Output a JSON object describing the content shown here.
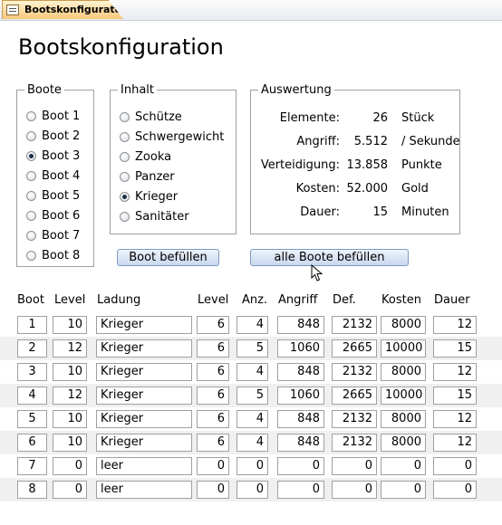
{
  "tab": {
    "label": "Bootskonfigurator"
  },
  "page_title": "Bootskonfiguration",
  "boote": {
    "legend": "Boote",
    "items": [
      "Boot 1",
      "Boot 2",
      "Boot 3",
      "Boot 4",
      "Boot 5",
      "Boot 6",
      "Boot 7",
      "Boot 8"
    ],
    "selected": "Boot 3"
  },
  "inhalt": {
    "legend": "Inhalt",
    "items": [
      "Schütze",
      "Schwergewicht",
      "Zooka",
      "Panzer",
      "Krieger",
      "Sanitäter"
    ],
    "selected": "Krieger"
  },
  "auswertung": {
    "legend": "Auswertung",
    "rows": [
      {
        "label": "Elemente:",
        "value": "26",
        "unit": "Stück"
      },
      {
        "label": "Angriff:",
        "value": "5.512",
        "unit": "/ Sekunde"
      },
      {
        "label": "Verteidigung:",
        "value": "13.858",
        "unit": "Punkte"
      },
      {
        "label": "Kosten:",
        "value": "52.000",
        "unit": "Gold"
      },
      {
        "label": "Dauer:",
        "value": "15",
        "unit": "Minuten"
      }
    ]
  },
  "buttons": {
    "fill_boat": "Boot befüllen",
    "fill_all": "alle Boote befüllen"
  },
  "table": {
    "headers": {
      "boot": "Boot",
      "level": "Level",
      "ladung": "Ladung",
      "level2": "Level",
      "anz": "Anz.",
      "angriff": "Angriff",
      "def": "Def.",
      "kosten": "Kosten",
      "dauer": "Dauer"
    },
    "rows": [
      [
        "1",
        "10",
        "Krieger",
        "6",
        "4",
        "848",
        "2132",
        "8000",
        "12"
      ],
      [
        "2",
        "12",
        "Krieger",
        "6",
        "5",
        "1060",
        "2665",
        "10000",
        "15"
      ],
      [
        "3",
        "10",
        "Krieger",
        "6",
        "4",
        "848",
        "2132",
        "8000",
        "12"
      ],
      [
        "4",
        "12",
        "Krieger",
        "6",
        "5",
        "1060",
        "2665",
        "10000",
        "15"
      ],
      [
        "5",
        "10",
        "Krieger",
        "6",
        "4",
        "848",
        "2132",
        "8000",
        "12"
      ],
      [
        "6",
        "10",
        "Krieger",
        "6",
        "4",
        "848",
        "2132",
        "8000",
        "12"
      ],
      [
        "7",
        "0",
        "leer",
        "0",
        "0",
        "0",
        "0",
        "0",
        "0"
      ],
      [
        "8",
        "0",
        "leer",
        "0",
        "0",
        "0",
        "0",
        "0",
        "0"
      ]
    ]
  }
}
